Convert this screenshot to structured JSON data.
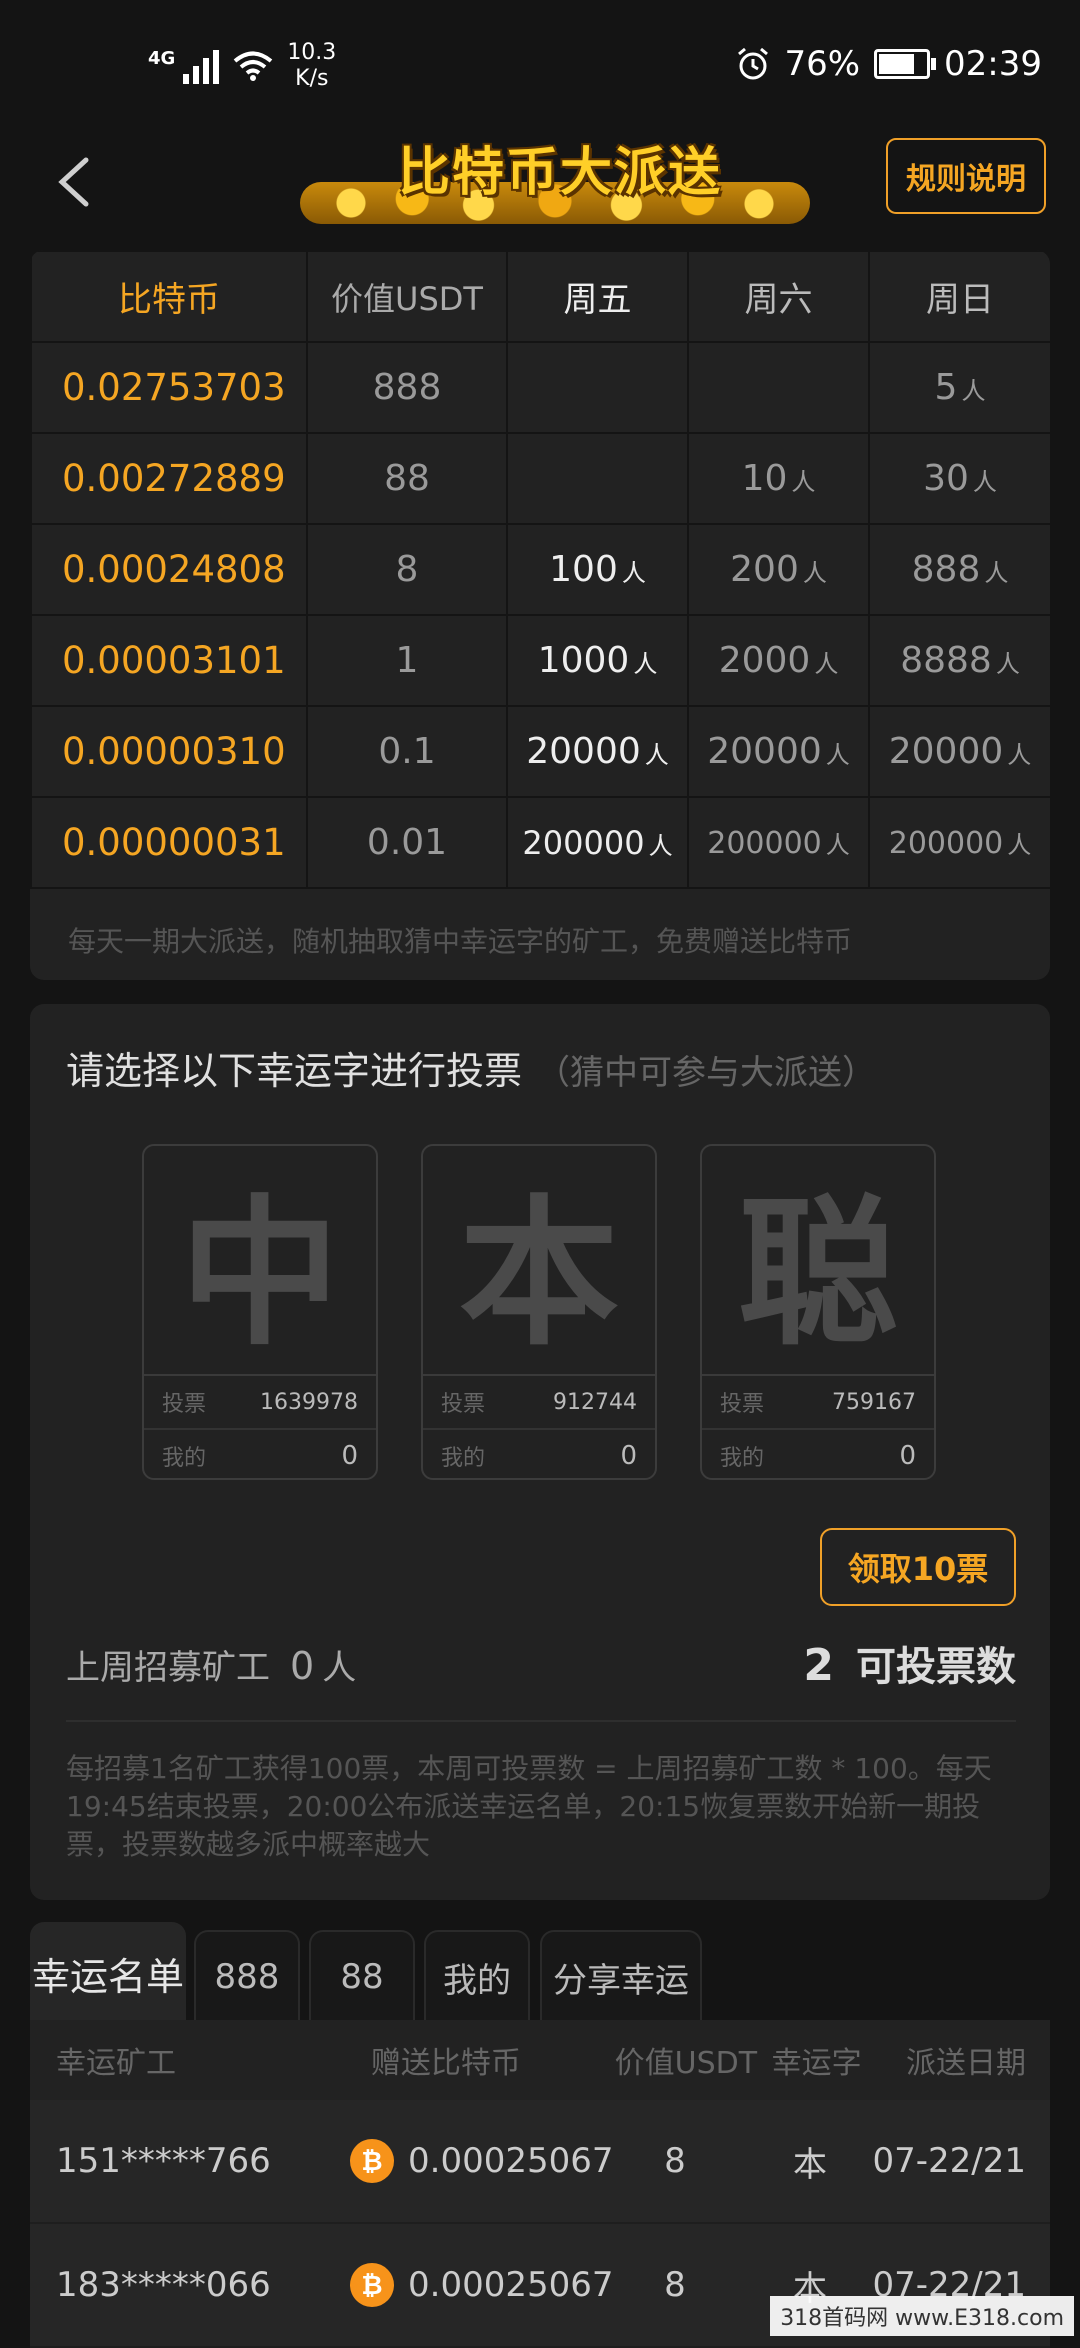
{
  "status_bar": {
    "network": "4G",
    "speed_value": "10.3",
    "speed_unit": "K/s",
    "battery": "76%",
    "time": "02:39"
  },
  "header": {
    "title": "比特币大派送",
    "rules_label": "规则说明"
  },
  "prize_table": {
    "headers": [
      "比特币",
      "价值USDT",
      "周五",
      "周六",
      "周日"
    ],
    "unit": "人",
    "rows": [
      {
        "btc": "0.02753703",
        "usdt": "888",
        "fri": "",
        "sat": "",
        "sun": "5"
      },
      {
        "btc": "0.00272889",
        "usdt": "88",
        "fri": "",
        "sat": "10",
        "sun": "30"
      },
      {
        "btc": "0.00024808",
        "usdt": "8",
        "fri": "100",
        "sat": "200",
        "sun": "888"
      },
      {
        "btc": "0.00003101",
        "usdt": "1",
        "fri": "1000",
        "sat": "2000",
        "sun": "8888"
      },
      {
        "btc": "0.00000310",
        "usdt": "0.1",
        "fri": "20000",
        "sat": "20000",
        "sun": "20000"
      },
      {
        "btc": "0.00000031",
        "usdt": "0.01",
        "fri": "200000",
        "sat": "200000",
        "sun": "200000"
      }
    ],
    "note": "每天一期大派送，随机抽取猜中幸运字的矿工，免费赠送比特币"
  },
  "vote": {
    "title": "请选择以下幸运字进行投票",
    "subtitle": "（猜中可参与大派送）",
    "votes_label": "投票",
    "mine_label": "我的",
    "cards": [
      {
        "char": "中",
        "votes": "1639978",
        "mine": "0"
      },
      {
        "char": "本",
        "votes": "912744",
        "mine": "0"
      },
      {
        "char": "聪",
        "votes": "759167",
        "mine": "0"
      }
    ],
    "claim_label": "领取10票",
    "recruit_label": "上周招募矿工",
    "recruit_value": "0",
    "recruit_unit": "人",
    "available_value": "2",
    "available_label": "可投票数",
    "note": "每招募1名矿工获得100票，本周可投票数 = 上周招募矿工数 * 100。每天19:45结束投票，20:00公布派送幸运名单，20:15恢复票数开始新一期投票，投票数越多派中概率越大"
  },
  "tabs": [
    "幸运名单",
    "888",
    "88",
    "我的",
    "分享幸运"
  ],
  "lucky_list": {
    "headers": [
      "幸运矿工",
      "赠送比特币",
      "价值USDT",
      "幸运字",
      "派送日期"
    ],
    "coin_symbol": "₿",
    "rows": [
      {
        "miner": "151*****766",
        "btc": "0.00025067",
        "usdt": "8",
        "char": "本",
        "date": "07-22/21"
      },
      {
        "miner": "183*****066",
        "btc": "0.00025067",
        "usdt": "8",
        "char": "本",
        "date": "07-22/21"
      }
    ]
  },
  "watermark": "318首码网 www.E318.com",
  "colors": {
    "accent": "#f5a623",
    "background": "#141414",
    "card": "#222222"
  }
}
